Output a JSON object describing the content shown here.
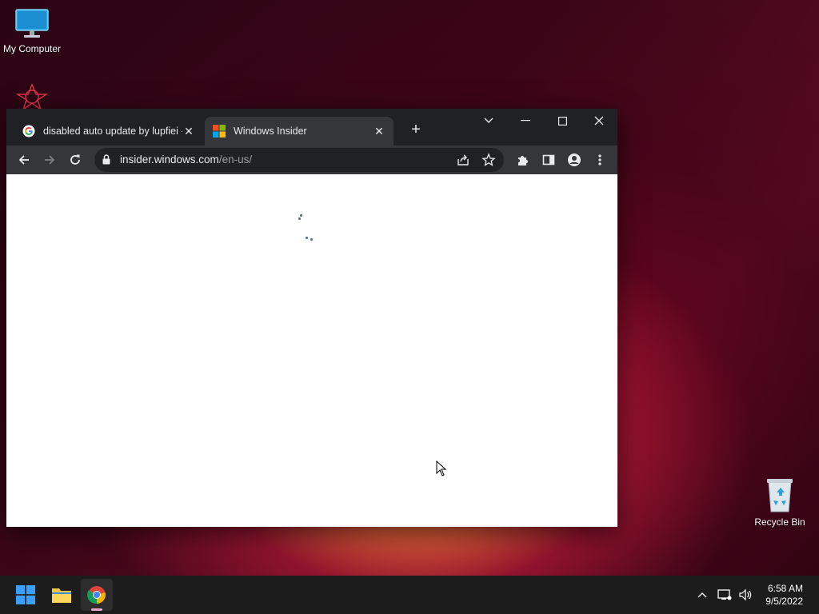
{
  "desktop": {
    "icons": [
      {
        "label": "My Computer"
      },
      {
        "label": "Recycle Bin"
      }
    ]
  },
  "browser": {
    "tabs": [
      {
        "title": "disabled auto update by lupfiei -",
        "favicon": "google-icon",
        "active": false
      },
      {
        "title": "Windows Insider",
        "favicon": "windows-logo-icon",
        "active": true
      }
    ],
    "address": {
      "host": "insider.windows.com",
      "path": "/en-us/"
    },
    "page_state": "loading"
  },
  "taskbar": {
    "apps": [
      "start-button",
      "file-explorer",
      "chrome"
    ],
    "time": "6:58 AM",
    "date": "9/5/2022"
  },
  "colors": {
    "chrome_frame": "#202124",
    "chrome_toolbar": "#35363a",
    "taskbar": "#1c1c1c"
  }
}
